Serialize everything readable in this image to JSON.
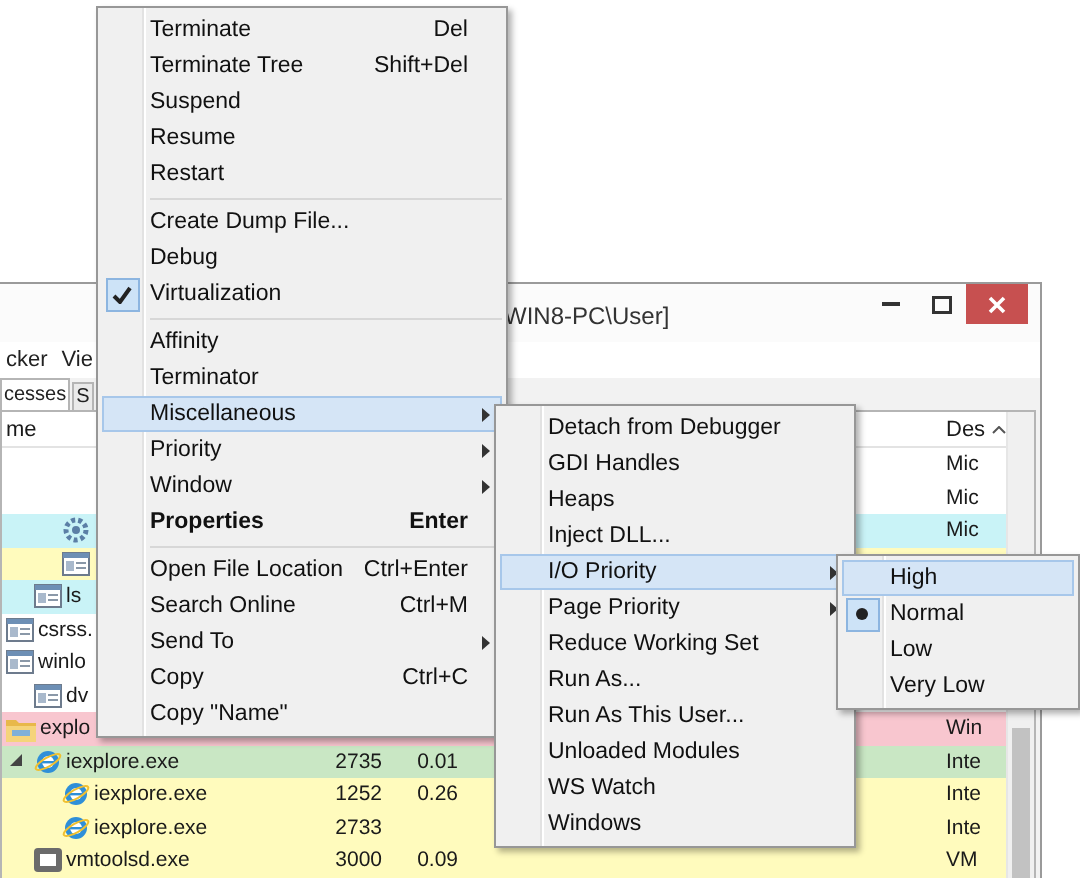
{
  "window": {
    "title": "WIN8-PC\\User]",
    "menu_bar": [
      "cker",
      "Vie"
    ],
    "tabs": [
      {
        "label": "cesses",
        "selected": true
      },
      {
        "label": "S",
        "selected": false
      }
    ],
    "columns": [
      {
        "label": "me"
      },
      {
        "label": "Des",
        "sorted": true
      }
    ],
    "rows": [
      {
        "kind": "blank",
        "description": "Mic",
        "children": [
          {
            "kind": "blank",
            "description": "Mic",
            "children": [
              {
                "kind": "service",
                "color": "#c9f3f7",
                "description": "Mic"
              },
              {
                "kind": "window",
                "color": "#fffbbd"
              }
            ]
          },
          {
            "kind": "window",
            "color": "#c9f3f7",
            "name": "ls"
          }
        ]
      },
      {
        "kind": "window",
        "name": "csrss."
      },
      {
        "kind": "window",
        "name": "winlo",
        "children": [
          {
            "kind": "window",
            "name": "dv"
          }
        ]
      },
      {
        "kind": "folder",
        "color": "#f8c6cf",
        "name": "explo",
        "description": "Win",
        "children": [
          {
            "kind": "browser",
            "color": "#c9e7c4",
            "name": "iexplore.exe",
            "pid": "2735",
            "cpu": "0.01",
            "description": "Inte",
            "expanded": true,
            "children": [
              {
                "kind": "browser",
                "color": "#fffbbd",
                "name": "iexplore.exe",
                "pid": "1252",
                "cpu": "0.26",
                "description": "Inte"
              },
              {
                "kind": "browser",
                "color": "#fffbbd",
                "name": "iexplore.exe",
                "pid": "2733",
                "description": "Inte"
              }
            ]
          },
          {
            "kind": "vm",
            "color": "#fffbbd",
            "name": "vmtoolsd.exe",
            "pid": "3000",
            "cpu": "0.09",
            "description": "VM"
          }
        ]
      }
    ]
  },
  "context_menu": {
    "groups": [
      [
        {
          "label": "Terminate",
          "shortcut": "Del",
          "has_submenu": false,
          "checked": false,
          "default": false,
          "selected": false
        },
        {
          "label": "Terminate Tree",
          "shortcut": "Shift+Del",
          "has_submenu": false,
          "checked": false,
          "default": false,
          "selected": false
        },
        {
          "label": "Suspend",
          "has_submenu": false,
          "checked": false,
          "default": false,
          "selected": false
        },
        {
          "label": "Resume",
          "has_submenu": false,
          "checked": false,
          "default": false,
          "selected": false
        },
        {
          "label": "Restart",
          "has_submenu": false,
          "checked": false,
          "default": false,
          "selected": false
        }
      ],
      [
        {
          "label": "Create Dump File...",
          "has_submenu": false,
          "checked": false,
          "default": false,
          "selected": false
        },
        {
          "label": "Debug",
          "has_submenu": false,
          "checked": false,
          "default": false,
          "selected": false
        },
        {
          "label": "Virtualization",
          "has_submenu": false,
          "checked": true,
          "default": false,
          "selected": false
        }
      ],
      [
        {
          "label": "Affinity",
          "has_submenu": false,
          "checked": false,
          "default": false,
          "selected": false
        },
        {
          "label": "Terminator",
          "has_submenu": false,
          "checked": false,
          "default": false,
          "selected": false
        },
        {
          "label": "Miscellaneous",
          "has_submenu": true,
          "checked": false,
          "default": false,
          "selected": true
        },
        {
          "label": "Priority",
          "has_submenu": true,
          "checked": false,
          "default": false,
          "selected": false
        },
        {
          "label": "Window",
          "has_submenu": true,
          "checked": false,
          "default": false,
          "selected": false
        },
        {
          "label": "Properties",
          "shortcut": "Enter",
          "has_submenu": false,
          "checked": false,
          "default": true,
          "selected": false
        }
      ],
      [
        {
          "label": "Open File Location",
          "shortcut": "Ctrl+Enter",
          "has_submenu": false,
          "checked": false,
          "default": false,
          "selected": false
        },
        {
          "label": "Search Online",
          "shortcut": "Ctrl+M",
          "has_submenu": false,
          "checked": false,
          "default": false,
          "selected": false
        },
        {
          "label": "Send To",
          "has_submenu": true,
          "checked": false,
          "default": false,
          "selected": false
        },
        {
          "label": "Copy",
          "shortcut": "Ctrl+C",
          "has_submenu": false,
          "checked": false,
          "default": false,
          "selected": false
        },
        {
          "label": "Copy \"Name\"",
          "has_submenu": false,
          "checked": false,
          "default": false,
          "selected": false
        }
      ]
    ]
  },
  "submenu": {
    "groups": [
      [
        {
          "label": "Detach from Debugger",
          "has_submenu": false,
          "checked": false,
          "default": false,
          "selected": false
        },
        {
          "label": "GDI Handles",
          "has_submenu": false,
          "checked": false,
          "default": false,
          "selected": false
        },
        {
          "label": "Heaps",
          "has_submenu": false,
          "checked": false,
          "default": false,
          "selected": false
        },
        {
          "label": "Inject DLL...",
          "has_submenu": false,
          "checked": false,
          "default": false,
          "selected": false
        },
        {
          "label": "I/O Priority",
          "has_submenu": true,
          "checked": false,
          "default": false,
          "selected": true
        },
        {
          "label": "Page Priority",
          "has_submenu": true,
          "checked": false,
          "default": false,
          "selected": false
        },
        {
          "label": "Reduce Working Set",
          "has_submenu": false,
          "checked": false,
          "default": false,
          "selected": false
        },
        {
          "label": "Run As...",
          "has_submenu": false,
          "checked": false,
          "default": false,
          "selected": false
        },
        {
          "label": "Run As This User...",
          "has_submenu": false,
          "checked": false,
          "default": false,
          "selected": false
        },
        {
          "label": "Unloaded Modules",
          "has_submenu": false,
          "checked": false,
          "default": false,
          "selected": false
        },
        {
          "label": "WS Watch",
          "has_submenu": false,
          "checked": false,
          "default": false,
          "selected": false
        },
        {
          "label": "Windows",
          "has_submenu": false,
          "checked": false,
          "default": false,
          "selected": false
        }
      ]
    ]
  },
  "priority_menu": {
    "groups": [
      [
        {
          "label": "High",
          "has_submenu": false,
          "bullet": false,
          "default": false,
          "selected": true
        },
        {
          "label": "Normal",
          "has_submenu": false,
          "bullet": true,
          "default": false,
          "selected": false
        },
        {
          "label": "Low",
          "has_submenu": false,
          "bullet": false,
          "default": false,
          "selected": false
        },
        {
          "label": "Very Low",
          "has_submenu": false,
          "bullet": false,
          "default": false,
          "selected": false
        }
      ]
    ]
  }
}
